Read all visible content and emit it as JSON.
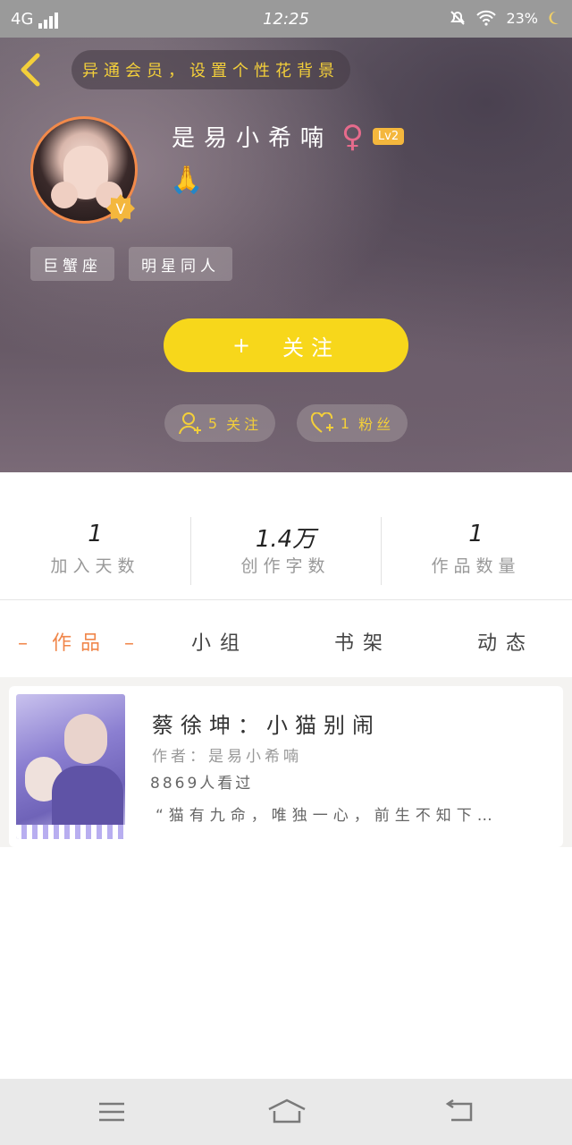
{
  "status": {
    "network": "4G",
    "time": "12:25",
    "battery": "23%"
  },
  "header": {
    "back_icon": "chevron-left-icon",
    "tip": "异通会员，设置个性花背景"
  },
  "profile": {
    "name": "是易小希喃",
    "gender_symbol": "♀",
    "level": "Lv2",
    "signature": "🙏",
    "verified_badge": "V",
    "tags": [
      "巨蟹座",
      "明星同人"
    ]
  },
  "follow_button": {
    "icon": "+",
    "label": "关注"
  },
  "social": {
    "following": {
      "count": "5",
      "label": "关注"
    },
    "fans": {
      "count": "1",
      "label": "粉丝"
    }
  },
  "stats": [
    {
      "value": "1",
      "label": "加入天数"
    },
    {
      "value": "1.4万",
      "label": "创作字数"
    },
    {
      "value": "1",
      "label": "作品数量"
    }
  ],
  "tabs": [
    {
      "label": "作品",
      "active": true
    },
    {
      "label": "小组",
      "active": false
    },
    {
      "label": "书架",
      "active": false
    },
    {
      "label": "动态",
      "active": false
    }
  ],
  "works": [
    {
      "title": "蔡徐坤：小猫别闹",
      "author": "作者：是易小希喃",
      "views": "8869人看过",
      "quote": "“猫有九命，唯独一心，前生不知下…"
    }
  ],
  "colors": {
    "accent": "#f7d71b",
    "tab_active": "#f0864a",
    "tip_text": "#f3cf3a"
  }
}
